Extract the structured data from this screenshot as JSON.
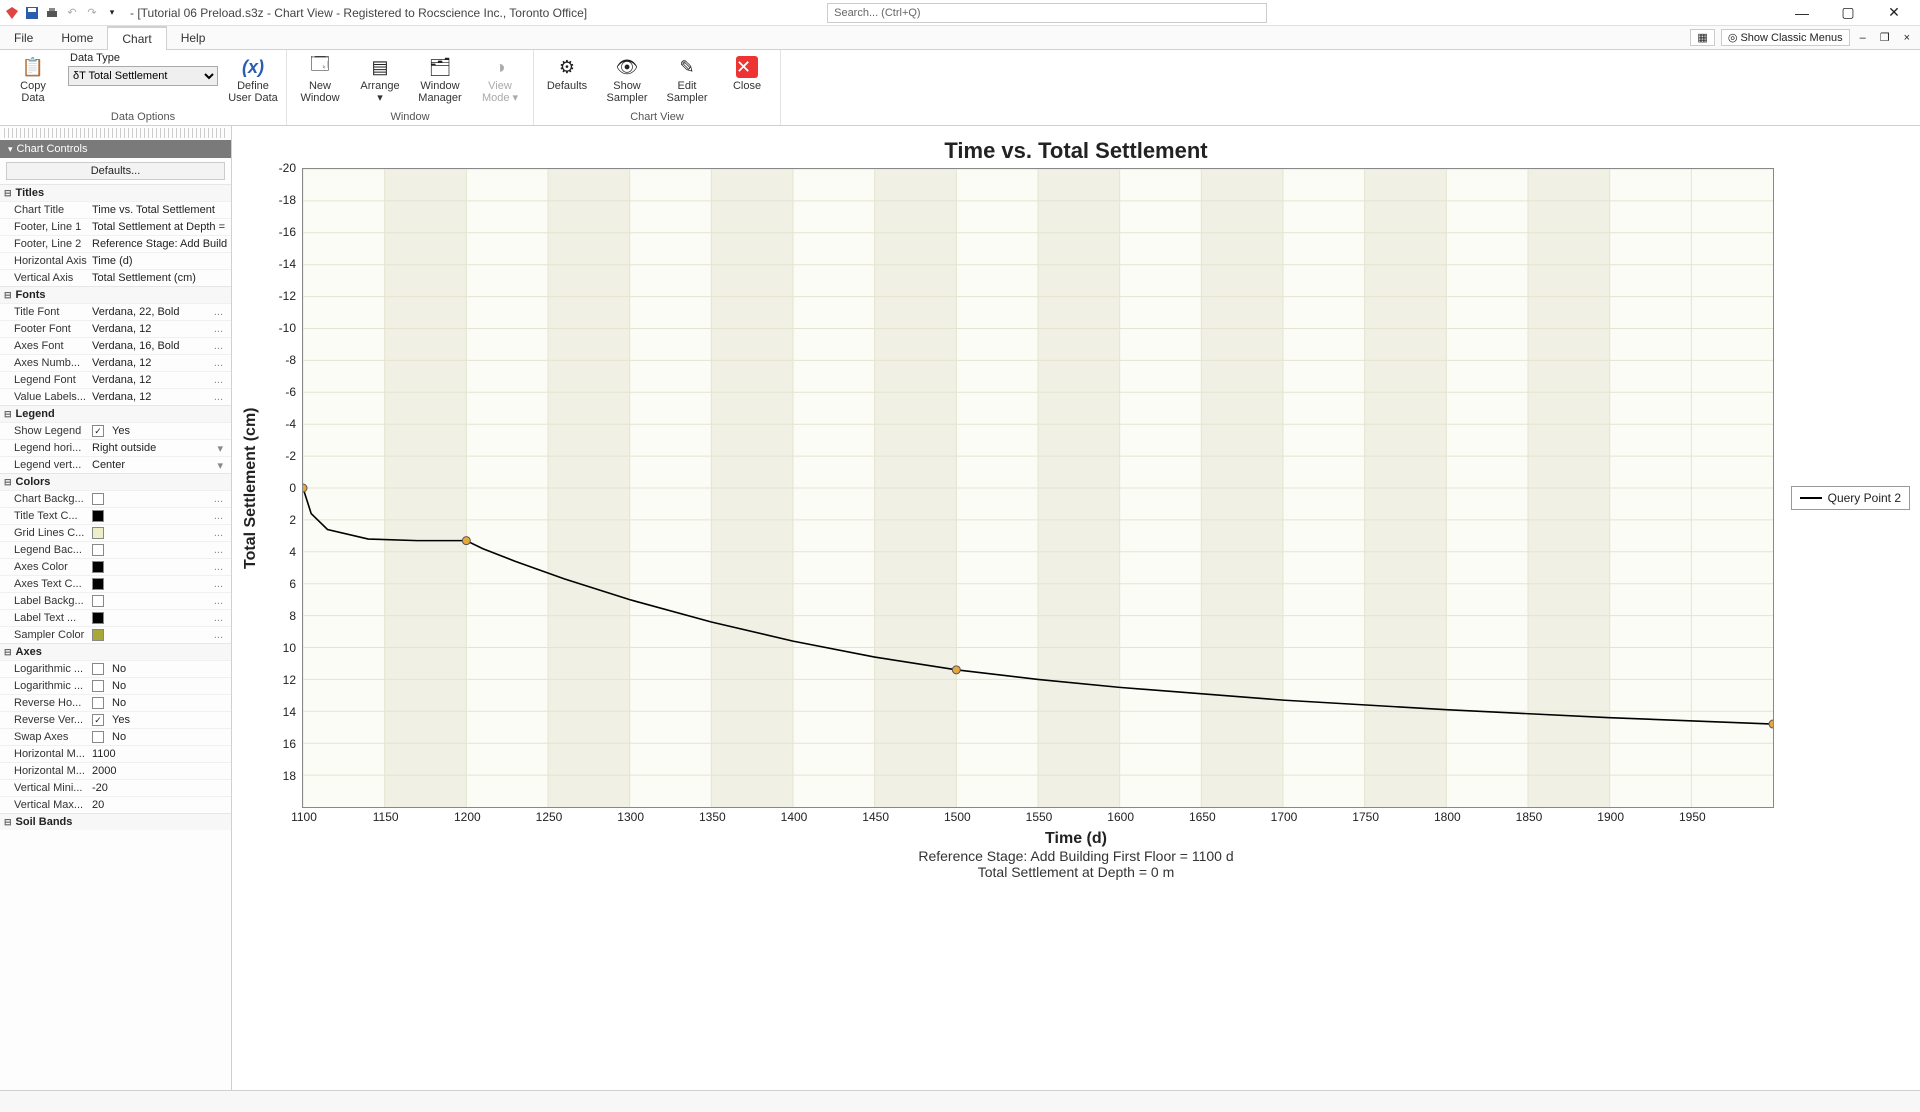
{
  "window": {
    "title": "- [Tutorial 06 Preload.s3z - Chart View - Registered to Rocscience Inc., Toronto Office]",
    "search_placeholder": "Search... (Ctrl+Q)",
    "show_classic_menus": "Show Classic Menus"
  },
  "menu": {
    "file": "File",
    "home": "Home",
    "chart": "Chart",
    "help": "Help"
  },
  "ribbon": {
    "copy_data": "Copy\nData",
    "data_type_label": "Data Type",
    "data_type_value": "δT Total Settlement",
    "define_user_data": "Define\nUser Data",
    "group_data_options": "Data Options",
    "new_window": "New\nWindow",
    "arrange": "Arrange",
    "window_manager": "Window\nManager",
    "view_mode": "View\nMode",
    "group_window": "Window",
    "defaults": "Defaults",
    "show_sampler": "Show\nSampler",
    "edit_sampler": "Edit\nSampler",
    "close": "Close",
    "group_chart_view": "Chart View"
  },
  "sidebar": {
    "header": "Chart Controls",
    "defaults_btn": "Defaults...",
    "sections": {
      "titles": {
        "label": "Titles",
        "rows": [
          {
            "k": "Chart Title",
            "v": "Time vs. Total Settlement"
          },
          {
            "k": "Footer, Line 1",
            "v": "Total Settlement at Depth = 0 m"
          },
          {
            "k": "Footer, Line 2",
            "v": "Reference Stage: Add Building Fir..."
          },
          {
            "k": "Horizontal Axis",
            "v": "Time (d)"
          },
          {
            "k": "Vertical Axis",
            "v": "Total Settlement (cm)"
          }
        ]
      },
      "fonts": {
        "label": "Fonts",
        "rows": [
          {
            "k": "Title Font",
            "v": "Verdana, 22, Bold",
            "dots": true
          },
          {
            "k": "Footer Font",
            "v": "Verdana, 12",
            "dots": true
          },
          {
            "k": "Axes Font",
            "v": "Verdana, 16, Bold",
            "dots": true
          },
          {
            "k": "Axes Numb...",
            "v": "Verdana, 12",
            "dots": true
          },
          {
            "k": "Legend Font",
            "v": "Verdana, 12",
            "dots": true
          },
          {
            "k": "Value Labels...",
            "v": "Verdana, 12",
            "dots": true
          }
        ]
      },
      "legend": {
        "label": "Legend",
        "rows": [
          {
            "k": "Show Legend",
            "v": "Yes",
            "cb": true,
            "checked": true
          },
          {
            "k": "Legend hori...",
            "v": "Right outside",
            "dd": true
          },
          {
            "k": "Legend vert...",
            "v": "Center",
            "dd": true
          }
        ]
      },
      "colors": {
        "label": "Colors",
        "rows": [
          {
            "k": "Chart Backg...",
            "sw": "#ffffff",
            "dots": true
          },
          {
            "k": "Title Text C...",
            "sw": "#000000",
            "dots": true
          },
          {
            "k": "Grid Lines C...",
            "sw": "#eeeecb",
            "dots": true
          },
          {
            "k": "Legend Bac...",
            "sw": "#ffffff",
            "dots": true
          },
          {
            "k": "Axes Color",
            "sw": "#000000",
            "dots": true
          },
          {
            "k": "Axes Text C...",
            "sw": "#000000",
            "dots": true
          },
          {
            "k": "Label Backg...",
            "sw": "#ffffff",
            "dots": true
          },
          {
            "k": "Label Text ...",
            "sw": "#000000",
            "dots": true
          },
          {
            "k": "Sampler Color",
            "sw": "#a8a838",
            "dots": true
          }
        ]
      },
      "axes": {
        "label": "Axes",
        "rows": [
          {
            "k": "Logarithmic ...",
            "v": "No",
            "cb": true,
            "checked": false
          },
          {
            "k": "Logarithmic ...",
            "v": "No",
            "cb": true,
            "checked": false
          },
          {
            "k": "Reverse Ho...",
            "v": "No",
            "cb": true,
            "checked": false
          },
          {
            "k": "Reverse Ver...",
            "v": "Yes",
            "cb": true,
            "checked": true
          },
          {
            "k": "Swap Axes",
            "v": "No",
            "cb": true,
            "checked": false
          },
          {
            "k": "Horizontal M...",
            "v": "1100"
          },
          {
            "k": "Horizontal M...",
            "v": "2000"
          },
          {
            "k": "Vertical Mini...",
            "v": "-20"
          },
          {
            "k": "Vertical Max...",
            "v": "20"
          }
        ]
      },
      "soil_bands": {
        "label": "Soil Bands"
      }
    }
  },
  "chart_data": {
    "type": "line",
    "title": "Time vs. Total Settlement",
    "xlabel": "Time (d)",
    "ylabel": "Total Settlement (cm)",
    "xlim": [
      1100,
      2000
    ],
    "ylim": [
      -20,
      20
    ],
    "y_reversed": true,
    "x_ticks": [
      1100,
      1150,
      1200,
      1250,
      1300,
      1350,
      1400,
      1450,
      1500,
      1550,
      1600,
      1650,
      1700,
      1750,
      1800,
      1850,
      1900,
      1950
    ],
    "y_ticks": [
      -20,
      -18,
      -16,
      -14,
      -12,
      -10,
      -8,
      -6,
      -4,
      -2,
      0,
      2,
      4,
      6,
      8,
      10,
      12,
      14,
      16,
      18
    ],
    "series": [
      {
        "name": "Query Point 2",
        "x": [
          1100,
          1105,
          1115,
          1140,
          1170,
          1200,
          1210,
          1230,
          1260,
          1300,
          1350,
          1400,
          1450,
          1500,
          1550,
          1600,
          1700,
          1800,
          1900,
          2000
        ],
        "y": [
          0.0,
          1.6,
          2.6,
          3.2,
          3.3,
          3.3,
          3.8,
          4.6,
          5.7,
          7.0,
          8.4,
          9.6,
          10.6,
          11.4,
          12.0,
          12.5,
          13.3,
          13.9,
          14.4,
          14.8
        ],
        "markers_x": [
          1100,
          1200,
          1500,
          2000
        ],
        "markers_y": [
          0.0,
          3.3,
          11.4,
          14.8
        ]
      }
    ],
    "footer1": "Reference Stage: Add Building First Floor = 1100 d",
    "footer2": "Total Settlement at Depth = 0 m",
    "legend_position": "right-outside-center"
  }
}
